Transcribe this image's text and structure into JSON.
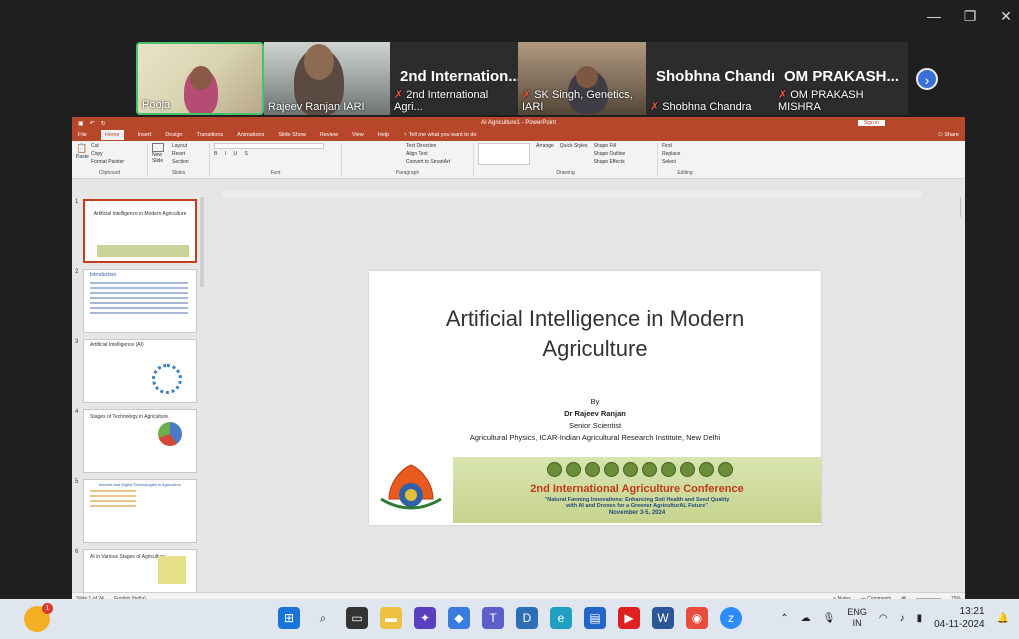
{
  "call": {
    "participants": [
      {
        "name": "Pooja"
      },
      {
        "name": "Rajeev Ranjan IARI"
      },
      {
        "title": "2nd Internation...",
        "name": "2nd International Agri..."
      },
      {
        "name": "SK Singh, Genetics, IARI"
      },
      {
        "title": "Shobhna Chandra",
        "name": "Shobhna Chandra"
      },
      {
        "title": "OM PRAKASH...",
        "name": "OM PRAKASH MISHRA"
      }
    ],
    "next_icon": "chevron-right-icon"
  },
  "ppt": {
    "window_title": "AI Agriculture1 - PowerPoint",
    "sign_in": "Sign in",
    "share": "Share",
    "tabs": [
      "File",
      "Home",
      "Insert",
      "Design",
      "Transitions",
      "Animations",
      "Slide Show",
      "Review",
      "View",
      "Help",
      "Tell me what you want to do"
    ],
    "ribbon": {
      "clipboard": {
        "items": [
          "Cut",
          "Copy",
          "Format Painter"
        ],
        "paste": "Paste",
        "caption": "Clipboard"
      },
      "slides": {
        "items": [
          "Layout",
          "Reset",
          "Section"
        ],
        "new_slide": "New Slide",
        "caption": "Slides"
      },
      "font_caption": "Font",
      "paragraph": {
        "items": [
          "Text Direction",
          "Align Text",
          "Convert to SmartArt"
        ],
        "caption": "Paragraph"
      },
      "drawing": {
        "items": [
          "Shape Fill",
          "Shape Outline",
          "Shape Effects"
        ],
        "arrange": "Arrange",
        "quick": "Quick Styles",
        "caption": "Drawing"
      },
      "editing": {
        "items": [
          "Find",
          "Replace",
          "Select"
        ],
        "caption": "Editing"
      }
    },
    "slide_numbers": [
      "1",
      "2",
      "3",
      "4",
      "5",
      "6"
    ],
    "thumbnails": [
      {
        "title": "Artificial Intelligence in Modern Agriculture"
      },
      {
        "title": "Introduction"
      },
      {
        "title": "Artificial Intelligence (AI)"
      },
      {
        "title": "Stages of Technology in Agriculture"
      },
      {
        "title": "Internet and Digital Technologies in Agriculture"
      },
      {
        "title": "AI in Various Stages of Agriculture"
      }
    ],
    "slide": {
      "title_line1": "Artificial Intelligence in Modern",
      "title_line2": "Agriculture",
      "by": "By",
      "author": "Dr Rajeev Ranjan",
      "role": "Senior Scientist",
      "affiliation": "Agricultural Physics, ICAR-Indian Agricultural Research Institute, New Delhi",
      "banner_title": "2nd International Agriculture Conference",
      "banner_sub1": "\"Natural Farming Innovations: Enhancing Soil Health and Seed Quality",
      "banner_sub2": "with AI and Drones for a Greener AgriculturAL Future\"",
      "banner_date": "November 3-5, 2024"
    },
    "status": {
      "slide_count": "Slide 1 of 24",
      "language": "English (India)",
      "notes": "Notes",
      "comments": "Comments",
      "zoom": "75%"
    }
  },
  "taskbar": {
    "weather_badge": "1",
    "lang_line1": "ENG",
    "lang_line2": "IN",
    "time": "13:21",
    "date": "04-11-2024"
  }
}
